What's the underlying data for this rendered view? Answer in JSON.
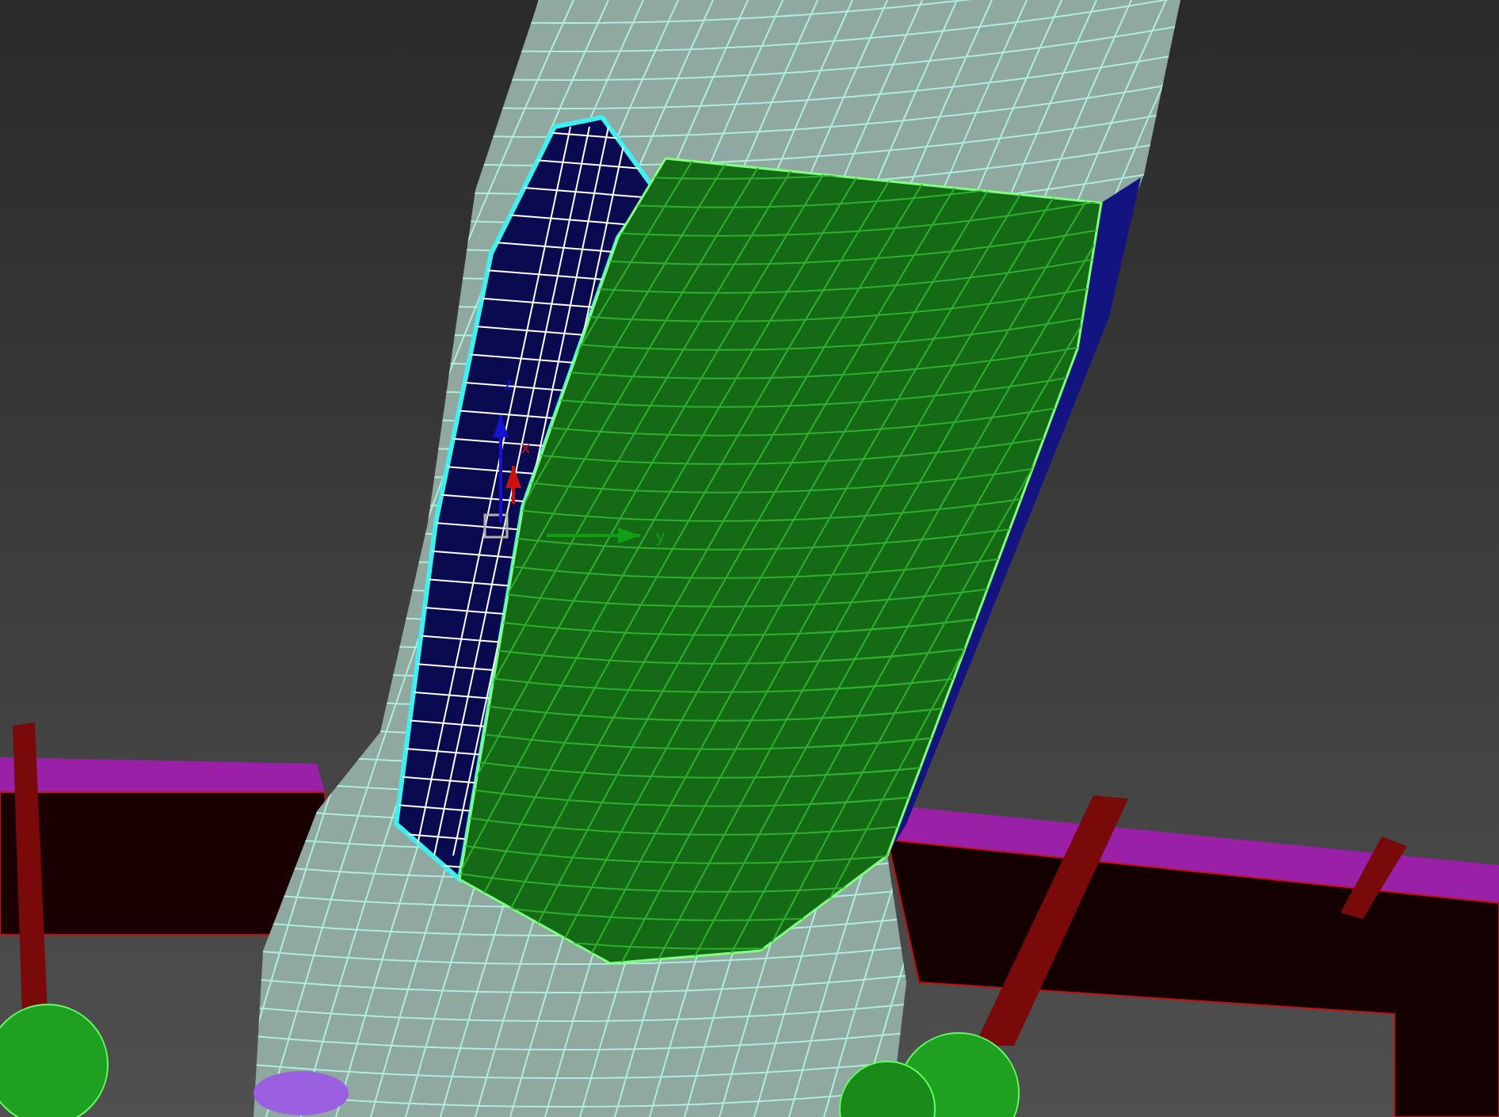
{
  "viewport": {
    "gizmo": {
      "axes": [
        {
          "label": "z",
          "color": "#1414d0"
        },
        {
          "label": "x",
          "color": "#d01010"
        },
        {
          "label": "y",
          "color": "#12a012"
        }
      ]
    }
  }
}
